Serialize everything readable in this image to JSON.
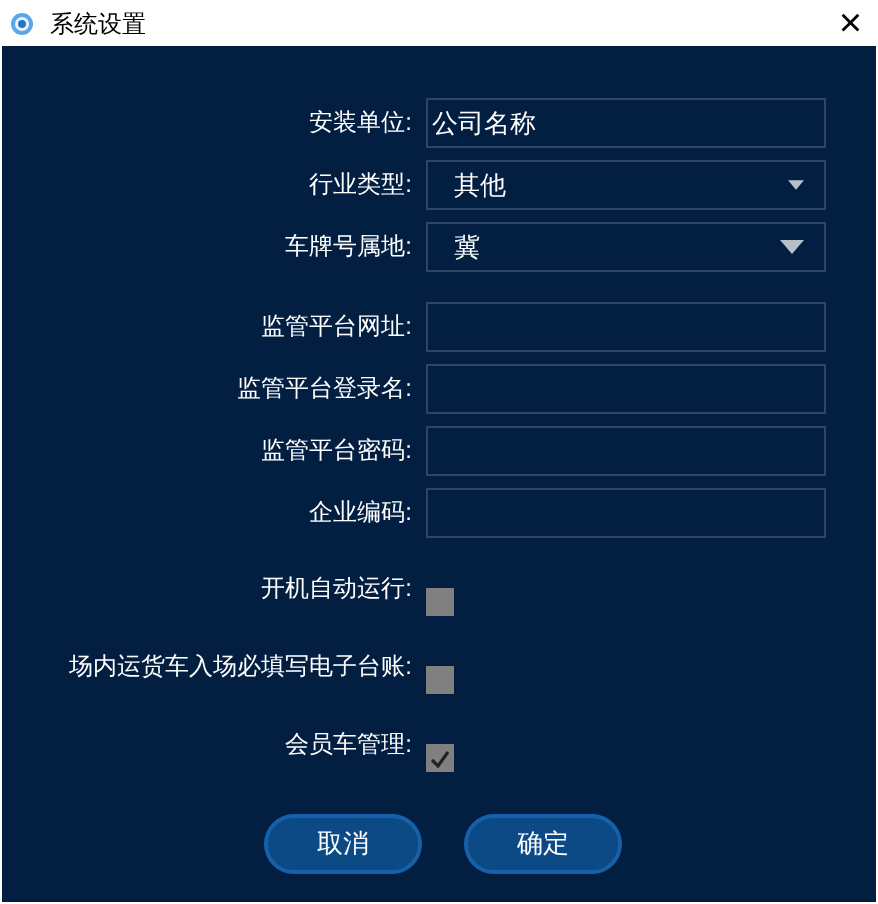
{
  "window": {
    "title": "系统设置",
    "close": "×"
  },
  "fields": [
    {
      "kind": "text",
      "label": "安装单位:",
      "value": "公司名称"
    },
    {
      "kind": "select",
      "label": "行业类型:",
      "value": "其他"
    },
    {
      "kind": "select",
      "label": "车牌号属地:",
      "value": "冀"
    },
    {
      "kind": "text",
      "label": "监管平台网址:"
    },
    {
      "kind": "text",
      "label": "监管平台登录名:"
    },
    {
      "kind": "text",
      "label": "监管平台密码:"
    },
    {
      "kind": "text",
      "label": "企业编码:"
    },
    {
      "kind": "checkbox",
      "label": "开机自动运行:",
      "checked": false
    },
    {
      "kind": "checkbox",
      "label": "场内运货车入场必填写电子台账:",
      "checked": false
    },
    {
      "kind": "checkbox",
      "label": "会员车管理:",
      "checked": true
    }
  ],
  "buttons": [
    "取消",
    "确定"
  ]
}
